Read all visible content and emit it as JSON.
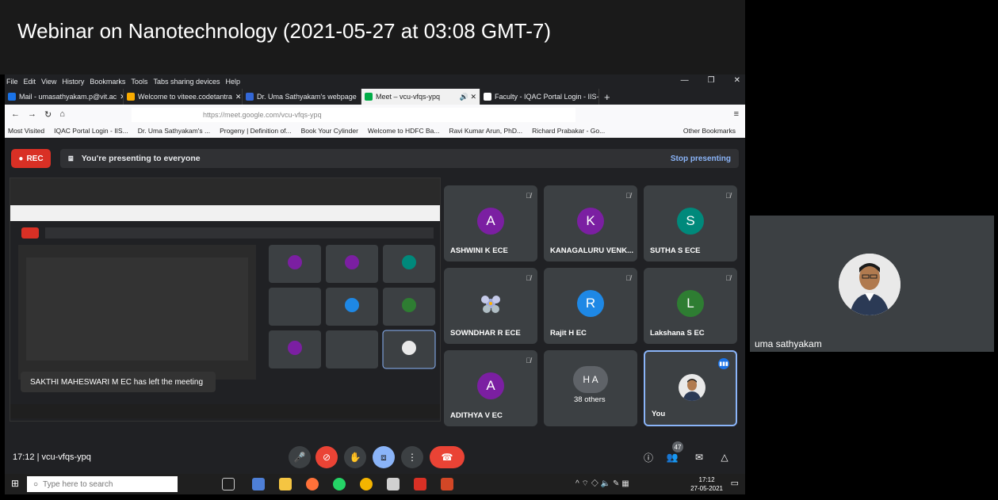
{
  "recording_title": "Webinar on Nanotechnology (2021-05-27 at 03:08 GMT-7)",
  "browser": {
    "menu": [
      "File",
      "Edit",
      "View",
      "History",
      "Bookmarks",
      "Tools",
      "Tabs sharing devices",
      "Help"
    ],
    "tabs": [
      {
        "label": "Mail - umasathyakam.p@vit.ac",
        "color": "#1a73e8"
      },
      {
        "label": "Welcome to viteee.codetantra",
        "color": "#f9ab00"
      },
      {
        "label": "Dr. Uma Sathyakam's webpage",
        "color": "#3367d6"
      },
      {
        "label": "Meet – vcu-vfqs-ypq",
        "color": "#00ac47"
      },
      {
        "label": "Faculty - IQAC Portal Login - IIS-IQ",
        "color": "#ffffff"
      }
    ],
    "url": "https://meet.google.com/vcu-vfqs-ypq",
    "bookmarks": [
      "Most Visited",
      "IQAC Portal Login - IIS...",
      "Dr. Uma Sathyakam's ...",
      "Progeny | Definition of...",
      "Book Your Cylinder",
      "Welcome to HDFC Ba...",
      "Ravi Kumar Arun, PhD...",
      "Richard Prabakar - Go...",
      "Other Bookmarks"
    ]
  },
  "meet": {
    "rec_label": "REC",
    "presenting_text": "You're presenting to everyone",
    "stop_presenting": "Stop presenting",
    "participants": [
      {
        "name": "ASHWINI K ECE",
        "initial": "A",
        "color": "#7b1fa2"
      },
      {
        "name": "KANAGALURU VENK...",
        "initial": "K",
        "color": "#7b1fa2"
      },
      {
        "name": "SUTHA S ECE",
        "initial": "S",
        "color": "#00897b"
      },
      {
        "name": "SOWNDHAR R ECE",
        "initial": "",
        "color": "#3c4043"
      },
      {
        "name": "Rajit H EC",
        "initial": "R",
        "color": "#1e88e5"
      },
      {
        "name": "Lakshana S EC",
        "initial": "L",
        "color": "#2e7d32"
      },
      {
        "name": "ADITHYA V EC",
        "initial": "A",
        "color": "#7b1fa2"
      },
      {
        "name": "38 others",
        "initial": "H A",
        "color": "#3c4043"
      },
      {
        "name": "You",
        "initial": "",
        "color": "#3c4043"
      }
    ],
    "toast": "SAKTHI MAHESWARI M EC has left the meeting",
    "meeting_info": "17:12  |  vcu-vfqs-ypq",
    "participant_count": "47"
  },
  "presenter_name": "uma sathyakam",
  "taskbar": {
    "search_placeholder": "Type here to search",
    "time": "17:12",
    "date": "27-05-2021"
  }
}
